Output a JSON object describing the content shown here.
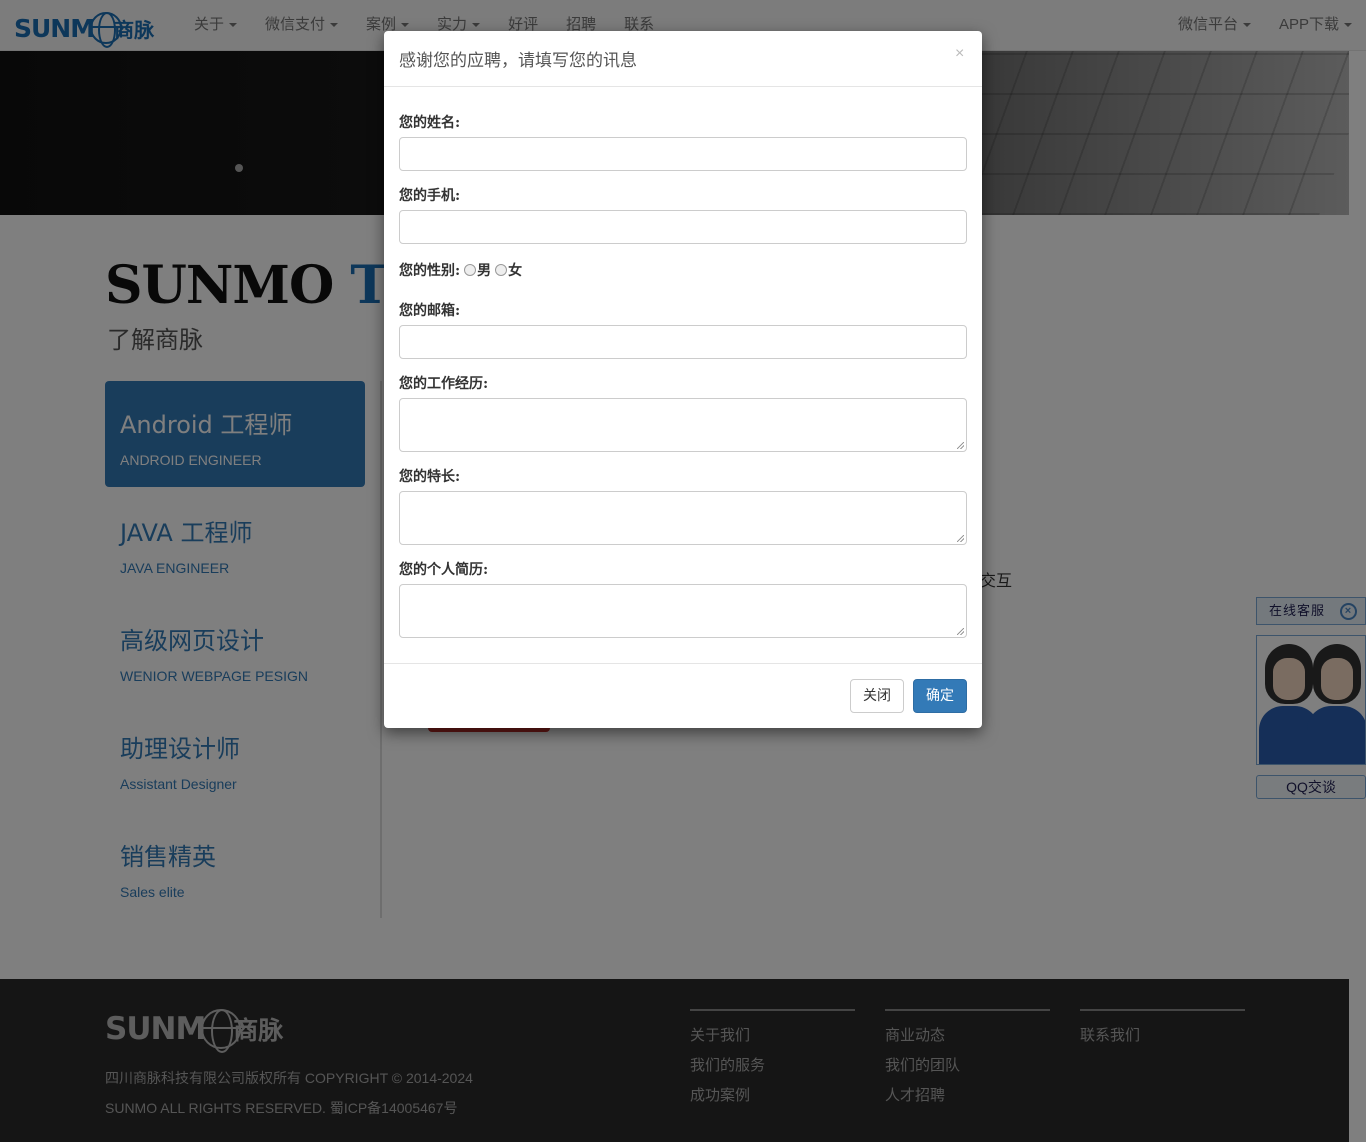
{
  "nav": {
    "logo_text": "SUNM",
    "logo_cn": "商脉",
    "items": [
      "关于",
      "微信支付",
      "案例",
      "实力",
      "好评",
      "招聘",
      "联系"
    ],
    "right_items": [
      "微信平台",
      "APP下载"
    ]
  },
  "main": {
    "team_title_a": "SUNMO ",
    "team_title_b": "TEAM",
    "team_subtitle": "了解商脉",
    "jobs": [
      {
        "title": "Android 工程师",
        "en": "ANDROID ENGINEER"
      },
      {
        "title": "JAVA 工程师",
        "en": "JAVA ENGINEER"
      },
      {
        "title": "高级网页设计",
        "en": "WENIOR WEBPAGE PESIGN"
      },
      {
        "title": "助理设计师",
        "en": "Assistant Designer"
      },
      {
        "title": "销售精英",
        "en": "Sales elite"
      }
    ],
    "side_text": "交互"
  },
  "modal": {
    "title": "感谢您的应聘，请填写您的讯息",
    "close_icon": "×",
    "fields": {
      "name": "您的姓名:",
      "phone": "您的手机:",
      "gender": "您的性别:",
      "male": "男",
      "female": "女",
      "email": "您的邮箱:",
      "experience": "您的工作经历:",
      "specialty": "您的特长:",
      "resume": "您的个人简历:"
    },
    "close_label": "关闭",
    "confirm_label": "确定"
  },
  "qq": {
    "header": "在线客服",
    "close": "×",
    "button": "QQ交谈"
  },
  "footer": {
    "copy1": "四川商脉科技有限公司版权所有 COPYRIGHT © 2014-2024",
    "copy2": "SUNMO ALL RIGHTS RESERVED. 蜀ICP备14005467号",
    "col1": [
      "关于我们",
      "我们的服务",
      "成功案例"
    ],
    "col2": [
      "商业动态",
      "我们的团队",
      "人才招聘"
    ],
    "col3": [
      "联系我们"
    ]
  },
  "colors": {
    "brand": "#1b6fb5",
    "primary": "#337ab7",
    "overlay": "rgba(0,0,0,0.5)"
  }
}
